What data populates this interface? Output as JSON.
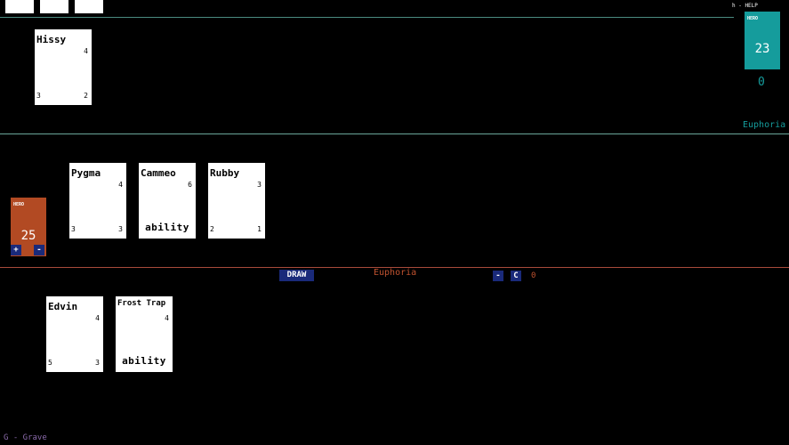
{
  "help_hint": "h - HELP",
  "opponent": {
    "hero_label": "HERO",
    "hero_health": "23",
    "counter": "0",
    "name": "Euphoria",
    "board": [
      {
        "name": "Hissy",
        "cost": "4",
        "attack": "3",
        "health": "2"
      }
    ]
  },
  "player": {
    "hero_label": "HERO",
    "hero_health": "25",
    "plus_label": "+",
    "minus_label": "-",
    "board": [
      {
        "name": "Pygma",
        "cost": "4",
        "attack": "3",
        "health": "3"
      },
      {
        "name": "Cammeo",
        "cost": "6",
        "ability": "ability"
      },
      {
        "name": "Rubby",
        "cost": "3",
        "attack": "2",
        "health": "1"
      }
    ],
    "hand": [
      {
        "name": "Edvin",
        "cost": "4",
        "attack": "5",
        "health": "3"
      },
      {
        "name": "Frost Trap",
        "cost": "4",
        "ability": "ability"
      }
    ]
  },
  "controls": {
    "draw_label": "DRAW",
    "player_name": "Euphoria",
    "minus_label": "-",
    "c_label": "C",
    "counter": "0"
  },
  "grave_hint": "G - Grave",
  "colors": {
    "opponent_accent": "#159c9c",
    "player_accent": "#b24a23",
    "button": "#1a2a7a"
  }
}
